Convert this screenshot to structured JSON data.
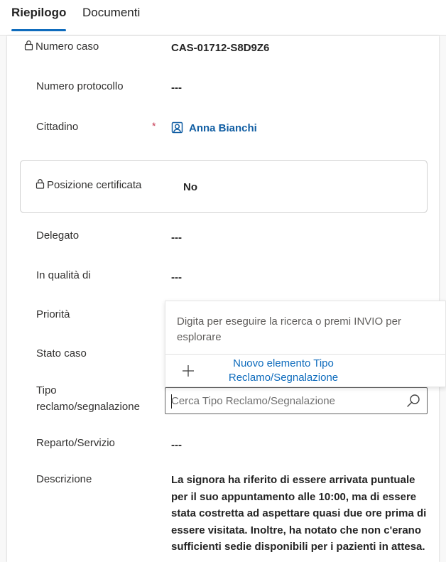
{
  "tabs": [
    {
      "label": "Riepilogo",
      "active": true
    },
    {
      "label": "Documenti",
      "active": false
    }
  ],
  "form": {
    "case_number": {
      "label": "Numero caso",
      "value": "CAS-01712-S8D9Z6",
      "locked": true
    },
    "protocol_number": {
      "label": "Numero protocollo",
      "value": "---"
    },
    "citizen": {
      "label": "Cittadino",
      "required_mark": "*",
      "value": "Anna Bianchi",
      "icon": "contact-icon"
    },
    "certified_position": {
      "label": "Posizione certificata",
      "value": "No",
      "locked": true
    },
    "delegate": {
      "label": "Delegato",
      "value": "---"
    },
    "capacity": {
      "label": "In qualità di",
      "value": "---"
    },
    "priority": {
      "label": "Priorità"
    },
    "case_status": {
      "label": "Stato caso"
    },
    "complaint_type": {
      "label_line1": "Tipo",
      "label_line2": "reclamo/segnalazione",
      "placeholder": "Cerca Tipo Reclamo/Segnalazione"
    },
    "department": {
      "label": "Reparto/Servizio",
      "value": "---"
    },
    "description": {
      "label": "Descrizione",
      "value": "La signora ha riferito di essere arrivata puntuale per il suo appuntamento alle 10:00, ma di essere stata costretta ad aspettare quasi due ore prima di essere visitata. Inoltre, ha notato che non c'erano sufficienti sedie disponibili per i pazienti in attesa."
    }
  },
  "lookup_dropdown": {
    "hint": "Digita per eseguire la ricerca o premi INVIO per esplorare",
    "new_item_line1": "Nuovo elemento Tipo",
    "new_item_line2": "Reclamo/Segnalazione"
  },
  "colors": {
    "accent": "#0f6cbd",
    "link": "#115ea3",
    "required": "#c4314b"
  }
}
